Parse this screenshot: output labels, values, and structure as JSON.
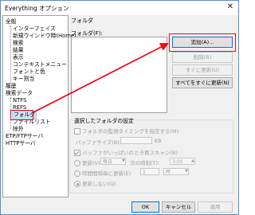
{
  "window": {
    "title": "Everything オプション"
  },
  "tree": {
    "general": "全般",
    "items": [
      "インターフェイス",
      "新規ウインドウ時(Home)",
      "検索",
      "結果",
      "表示",
      "コンテキストメニュー",
      "フォントと色",
      "キー割当"
    ],
    "history": "履歴",
    "search_data": "検索データ",
    "sub_items": [
      "NTFS",
      "REFS",
      "フォルダ",
      "ファイルリスト",
      "除外"
    ],
    "etp": "ETP/FTPサーバ",
    "http": "HTTPサーバ"
  },
  "panel": {
    "heading": "フォルダ",
    "folders_label": "フォルダ(F):",
    "buttons": {
      "add": "追加(A)...",
      "remove": "削除(R)",
      "update_now": "すぐに更新(U)",
      "update_all_now": "すべてをすぐに更新(N)"
    },
    "group_title": "選択したフォルダの設定",
    "options": {
      "monitor_timing": "フォルダの監視タイミングを指定する(M)",
      "buffer_size_label": "バッファサイズ(B):",
      "buffer_size_unit": "KB",
      "rescan_on_overflow": "バッファがいっぱいのとき再スキャン(B)",
      "update_label": "更新(V)",
      "update_freq": "毎日",
      "next_time_label": "次の時刻(T):",
      "next_time_value": "3:00",
      "interval_label": "時間間隔毎に更新(E)",
      "interval_value": "1",
      "interval_unit": "時",
      "no_update": "更新しない(Q)"
    }
  },
  "footer": {
    "ok": "OK",
    "cancel": "キャンセル",
    "apply": "適用"
  },
  "colors": {
    "highlight": "#e8101a",
    "selection": "#cce4f7",
    "accent_border": "#0078d7"
  }
}
